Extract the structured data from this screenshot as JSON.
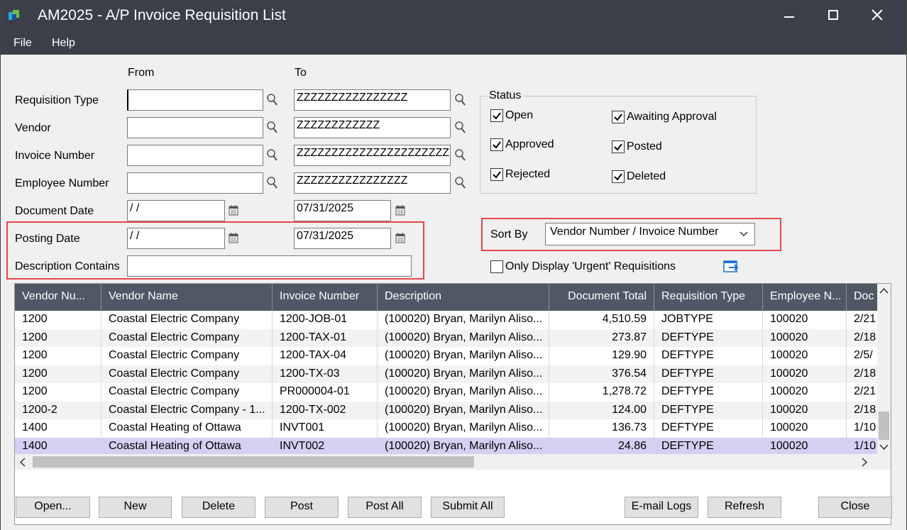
{
  "window": {
    "title": "AM2025 - A/P Invoice Requisition List"
  },
  "menu": [
    "File",
    "Help"
  ],
  "criteria": {
    "from_label": "From",
    "to_label": "To",
    "requisition_type": {
      "label": "Requisition Type",
      "from": "",
      "to": "ZZZZZZZZZZZZZZZZ"
    },
    "vendor": {
      "label": "Vendor",
      "from": "",
      "to": "ZZZZZZZZZZZZ"
    },
    "invoice_number": {
      "label": "Invoice Number",
      "from": "",
      "to": "ZZZZZZZZZZZZZZZZZZZZZZ"
    },
    "employee_number": {
      "label": "Employee Number",
      "from": "",
      "to": "ZZZZZZZZZZZZZZZZ"
    },
    "document_date": {
      "label": "Document Date",
      "from": " / /",
      "to": "07/31/2025"
    },
    "posting_date": {
      "label": "Posting Date",
      "from": " / /",
      "to": "07/31/2025"
    },
    "description_contains": {
      "label": "Description Contains",
      "value": ""
    }
  },
  "status": {
    "title": "Status",
    "open": {
      "label": "Open",
      "checked": true
    },
    "approved": {
      "label": "Approved",
      "checked": true
    },
    "rejected": {
      "label": "Rejected",
      "checked": true
    },
    "awaiting_approval": {
      "label": "Awaiting Approval",
      "checked": true
    },
    "posted": {
      "label": "Posted",
      "checked": true
    },
    "deleted": {
      "label": "Deleted",
      "checked": true
    }
  },
  "sort_by": {
    "label": "Sort By",
    "value": "Vendor Number / Invoice Number"
  },
  "urgent_only": {
    "label": "Only Display 'Urgent' Requisitions",
    "checked": false
  },
  "grid": {
    "columns": [
      "Vendor Nu...",
      "Vendor Name",
      "Invoice Number",
      "Description",
      "Document Total",
      "Requisition Type",
      "Employee N...",
      "Doc"
    ],
    "rows": [
      [
        "1200",
        "Coastal Electric Company",
        "1200-JOB-01",
        "(100020) Bryan, Marilyn Aliso...",
        "4,510.59",
        "JOBTYPE",
        "100020",
        "2/21"
      ],
      [
        "1200",
        "Coastal Electric Company",
        "1200-TAX-01",
        "(100020) Bryan, Marilyn Aliso...",
        "273.87",
        "DEFTYPE",
        "100020",
        "2/18"
      ],
      [
        "1200",
        "Coastal Electric Company",
        "1200-TAX-04",
        "(100020) Bryan, Marilyn Aliso...",
        "129.90",
        "DEFTYPE",
        "100020",
        "2/5/"
      ],
      [
        "1200",
        "Coastal Electric Company",
        "1200-TX-03",
        "(100020) Bryan, Marilyn Aliso...",
        "376.54",
        "DEFTYPE",
        "100020",
        "2/18"
      ],
      [
        "1200",
        "Coastal Electric Company",
        "PR000004-01",
        "(100020) Bryan, Marilyn Aliso...",
        "1,278.72",
        "DEFTYPE",
        "100020",
        "2/21"
      ],
      [
        "1200-2",
        "Coastal Electric Company - 1...",
        "1200-TX-002",
        "(100020) Bryan, Marilyn Aliso...",
        "124.00",
        "DEFTYPE",
        "100020",
        "2/18"
      ],
      [
        "1400",
        "Coastal Heating of Ottawa",
        "INVT001",
        "(100020) Bryan, Marilyn Aliso...",
        "136.73",
        "DEFTYPE",
        "100020",
        "1/10"
      ],
      [
        "1400",
        "Coastal Heating of Ottawa",
        "INVT002",
        "(100020) Bryan, Marilyn Aliso...",
        "24.86",
        "DEFTYPE",
        "100020",
        "1/10"
      ]
    ],
    "selected_row": 7
  },
  "buttons": {
    "open": "Open...",
    "new": "New",
    "delete": "Delete",
    "post": "Post",
    "post_all": "Post All",
    "submit_all": "Submit All",
    "email_logs": "E-mail Logs",
    "refresh": "Refresh",
    "close": "Close"
  },
  "colors": {
    "titlebar": "#3c3f4a",
    "grid_header": "#4f5864",
    "row_alt": "#f2f2f2",
    "row_selected": "#d4d0f2",
    "highlight_red": "#e5474f"
  }
}
